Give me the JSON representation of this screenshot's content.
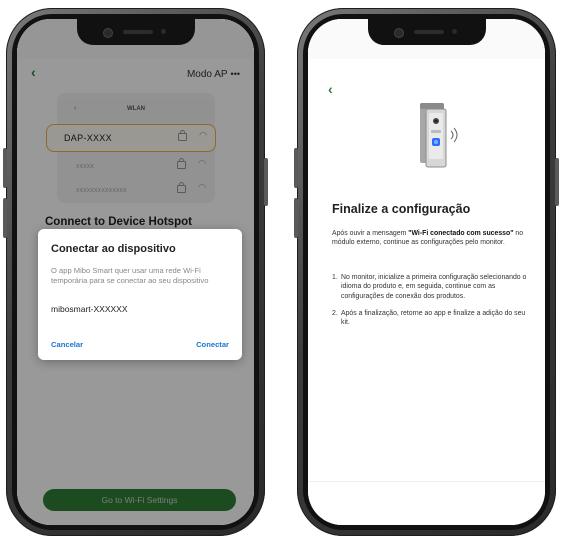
{
  "left_screen": {
    "header": {
      "back_icon": "back-arrow-icon",
      "mode_label": "Modo AP",
      "more_icon": "more-dots-icon"
    },
    "wifi_list": {
      "section_title": "WLAN",
      "networks": [
        {
          "name": "DAP-XXXX",
          "selected": true
        },
        {
          "name": "XXXXX",
          "selected": false
        },
        {
          "name": "XXXXXXXXXXXXXX",
          "selected": false
        }
      ]
    },
    "heading": "Connect to Device Hotspot",
    "dialog": {
      "title": "Conectar ao dispositivo",
      "body": "O app Mibo Smart quer usar uma rede Wi-Fi temporária para se conectar ao seu dispositivo",
      "ssid": "mibosmart-XXXXXX",
      "cancel_label": "Cancelar",
      "connect_label": "Conectar"
    },
    "settings_button_label": "Go to Wi-Fi Settings",
    "colors": {
      "accent": "#2e7d32",
      "link": "#1976d2",
      "selected_border": "#e8b24a"
    }
  },
  "right_screen": {
    "header": {
      "back_icon": "back-arrow-icon"
    },
    "image": "doorbell-device-icon",
    "title": "Finalize a configuração",
    "intro_before": "Após ouvir a mensagem ",
    "intro_bold": "\"Wi-Fi conectado com sucesso\"",
    "intro_after": " no módulo externo, continue as configurações pelo monitor.",
    "steps": [
      {
        "num": "1.",
        "text": "No monitor, inicialize a primeira configuração selecionando o idioma do produto e, em seguida, continue com as configurações de conexão dos produtos."
      },
      {
        "num": "2.",
        "text": "Após a finalização, retorne ao app e finalize a adição do seu kit."
      }
    ]
  }
}
